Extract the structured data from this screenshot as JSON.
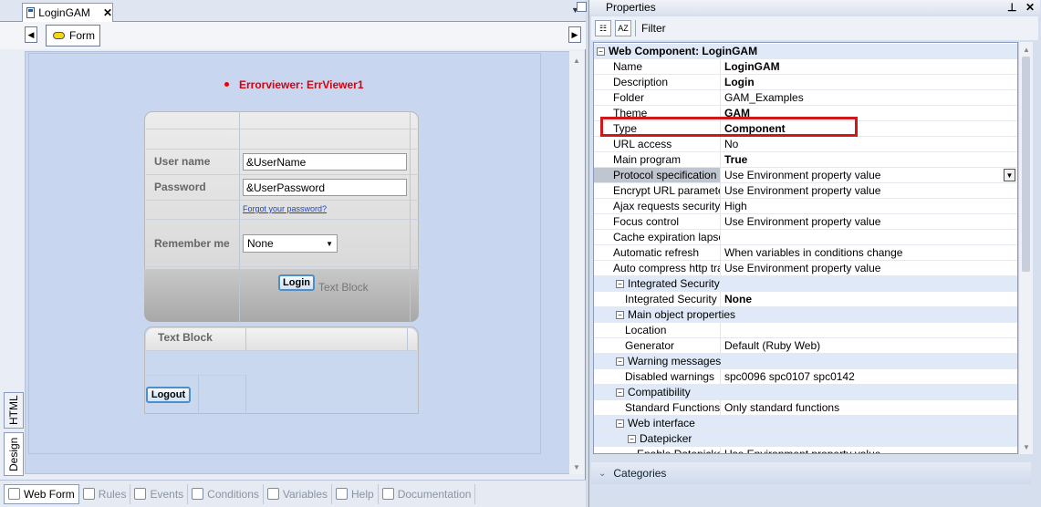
{
  "doc_tab": {
    "title": "LoginGAM",
    "close": "✕"
  },
  "toolbar": {
    "form_label": "Form"
  },
  "design": {
    "error_label": "Errorviewer: ErrViewer1",
    "username_label": "User name",
    "username_value": "&UserName",
    "password_label": "Password",
    "password_value": "&UserPassword",
    "forgot_link": "Forgot your password?",
    "remember_label": "Remember me",
    "remember_value": "None",
    "login_button": "Login",
    "text_block_1": "Text Block",
    "text_block_2": "Text Block",
    "logout_button": "Logout"
  },
  "side_tabs": {
    "html": "HTML",
    "design": "Design"
  },
  "bottom_tabs": [
    {
      "label": "Web Form"
    },
    {
      "label": "Rules"
    },
    {
      "label": "Events"
    },
    {
      "label": "Conditions"
    },
    {
      "label": "Variables"
    },
    {
      "label": "Help"
    },
    {
      "label": "Documentation"
    }
  ],
  "properties": {
    "title": "Properties",
    "pin": "ᵖ",
    "close": "✕",
    "filter_label": "Filter",
    "categories_label": "Categories",
    "rows": [
      {
        "name": "Web Component: LoginGAM",
        "value": "",
        "cat": true
      },
      {
        "name": "Name",
        "value": "LoginGAM",
        "bold": true
      },
      {
        "name": "Description",
        "value": "Login",
        "bold": true
      },
      {
        "name": "Folder",
        "value": "GAM_Examples"
      },
      {
        "name": "Theme",
        "value": "GAM",
        "bold": true
      },
      {
        "name": "Type",
        "value": "Component",
        "bold": true
      },
      {
        "name": "URL access",
        "value": "No"
      },
      {
        "name": "Main program",
        "value": "True",
        "bold": true
      },
      {
        "name": "Protocol specification",
        "value": "Use Environment property value",
        "selected": true
      },
      {
        "name": "Encrypt URL parameters",
        "value": "Use Environment property value"
      },
      {
        "name": "Ajax requests security",
        "value": "High"
      },
      {
        "name": "Focus control",
        "value": "Use Environment property value"
      },
      {
        "name": "Cache expiration lapse",
        "value": ""
      },
      {
        "name": "Automatic refresh",
        "value": "When variables in conditions change"
      },
      {
        "name": "Auto compress http traf",
        "value": "Use Environment property value"
      },
      {
        "name": "Integrated Security",
        "value": "",
        "cat": true,
        "level": 1
      },
      {
        "name": "Integrated Security L",
        "value": "None",
        "bold": true,
        "level": 1
      },
      {
        "name": "Main object properties",
        "value": "",
        "cat": true,
        "level": 1
      },
      {
        "name": "Location",
        "value": "",
        "level": 1
      },
      {
        "name": "Generator",
        "value": "Default (Ruby Web)",
        "level": 1
      },
      {
        "name": "Warning messages",
        "value": "",
        "cat": true,
        "level": 1
      },
      {
        "name": "Disabled warnings",
        "value": "spc0096 spc0107 spc0142",
        "level": 1
      },
      {
        "name": "Compatibility",
        "value": "",
        "cat": true,
        "level": 1
      },
      {
        "name": "Standard Functions",
        "value": "Only standard functions",
        "level": 1
      },
      {
        "name": "Web interface",
        "value": "",
        "cat": true,
        "level": 1
      },
      {
        "name": "Datepicker",
        "value": "",
        "cat": true,
        "level": 2
      },
      {
        "name": "Enable Datepicker",
        "value": "Use Environment property value",
        "level": 2
      }
    ]
  }
}
